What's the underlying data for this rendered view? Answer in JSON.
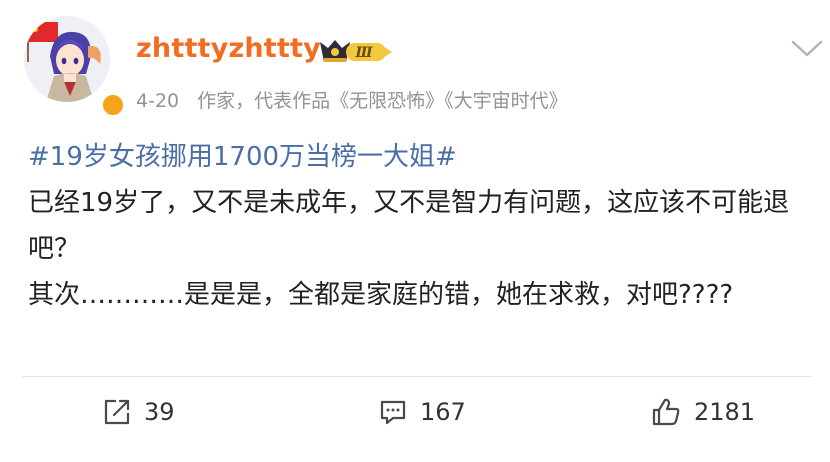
{
  "user": {
    "name": "zhtttyzhttty",
    "level_badge": "Ⅲ",
    "avatar_icon": "anime-avatar-with-flag",
    "verified_color": "#f7a21b",
    "name_color": "#f36c21"
  },
  "meta": {
    "date": "4-20",
    "description": "作家，代表作品《无限恐怖》《大宇宙时代》"
  },
  "post": {
    "topic": "#19岁女孩挪用1700万当榜一大姐#",
    "lines": [
      "已经19岁了，又不是未成年，又不是智力有问题，这应该不可能退吧？",
      "其次…………是是是，全都是家庭的错，她在求救，对吧????"
    ]
  },
  "actions": {
    "repost": {
      "icon": "repost-icon",
      "count": "39"
    },
    "comment": {
      "icon": "comment-icon",
      "count": "167"
    },
    "like": {
      "icon": "thumbs-up-icon",
      "count": "2181"
    }
  }
}
